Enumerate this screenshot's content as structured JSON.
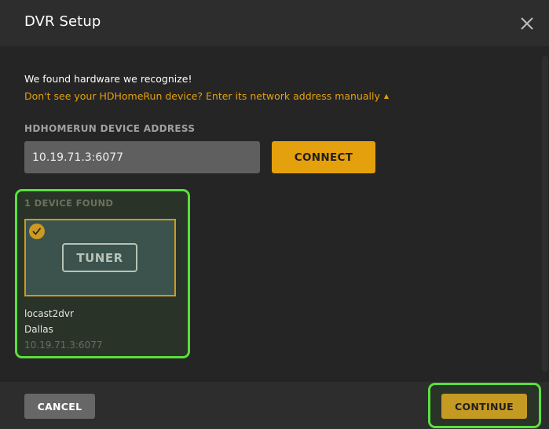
{
  "dialog": {
    "title": "DVR Setup",
    "close_icon": "close-icon"
  },
  "body": {
    "found_message": "We found hardware we recognize!",
    "manual_link": "Don't see your HDHomeRun device? Enter its network address manually",
    "manual_link_icon": "caret-up-icon",
    "address_label": "HDHOMERUN DEVICE ADDRESS",
    "address_value": "10.19.71.3:6077",
    "connect_label": "CONNECT"
  },
  "devices": {
    "count_label": "1 DEVICE FOUND",
    "items": [
      {
        "type_label": "TUNER",
        "selected": true,
        "name": "locast2dvr",
        "location": "Dallas",
        "address": "10.19.71.3:6077"
      }
    ]
  },
  "footer": {
    "cancel_label": "CANCEL",
    "continue_label": "CONTINUE"
  },
  "colors": {
    "accent": "#e5a00d",
    "highlight": "#5adf3f"
  }
}
